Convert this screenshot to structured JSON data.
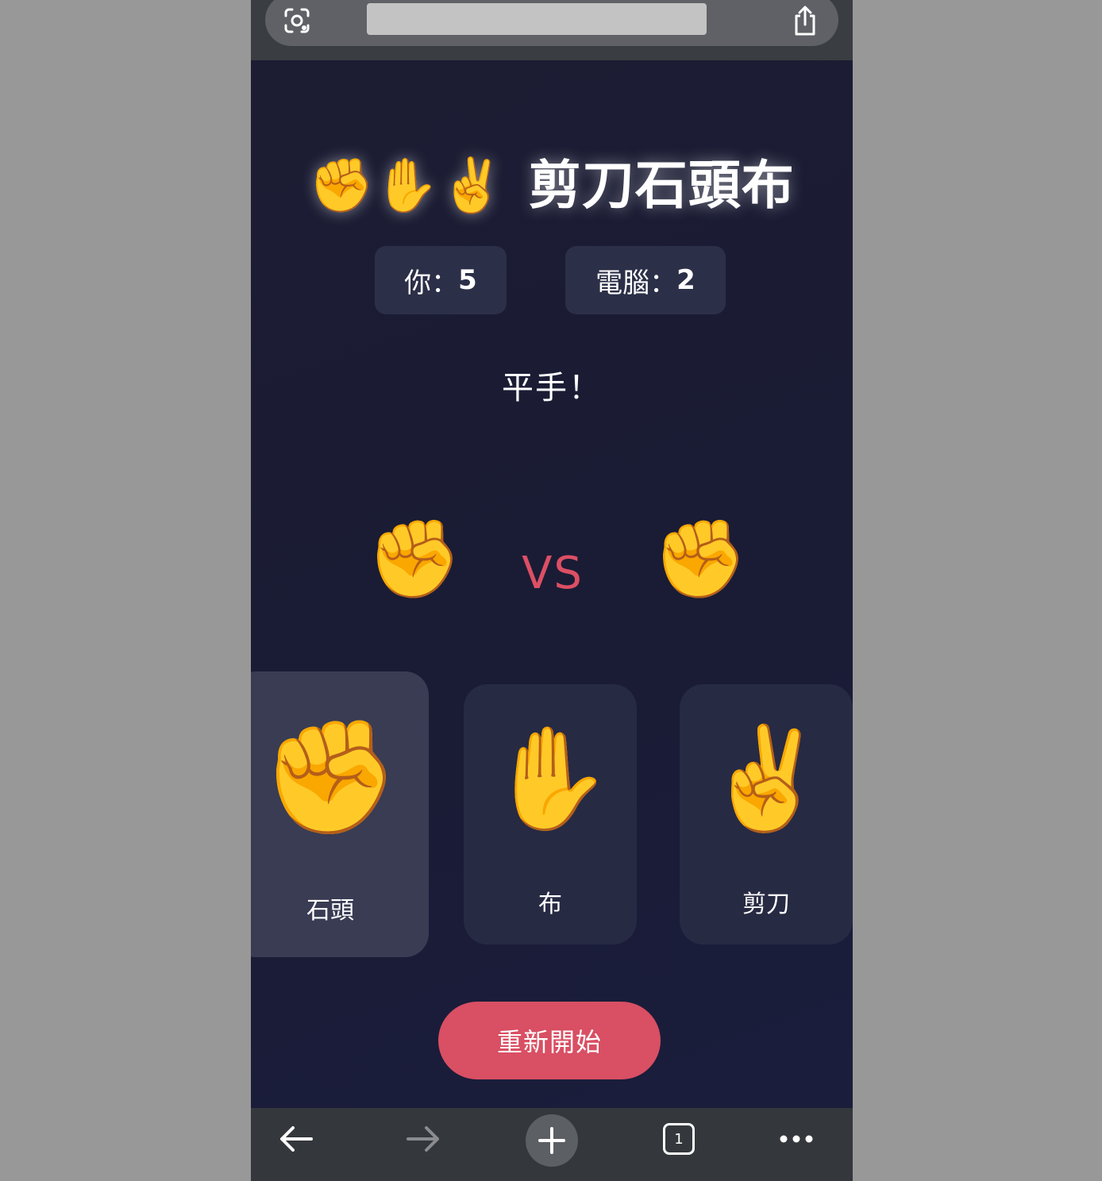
{
  "browser": {
    "lens_icon": "lens-icon",
    "share_icon": "share-icon"
  },
  "game": {
    "title_emojis": "✊✋✌️",
    "title_text": "剪刀石頭布",
    "score_player_label": "你：",
    "score_player_value": "5",
    "score_computer_label": "電腦：",
    "score_computer_value": "2",
    "result": "平手！",
    "player_hand": "✊",
    "computer_hand": "✊",
    "vs": "VS",
    "choices": [
      {
        "icon": "✊",
        "label": "石頭"
      },
      {
        "icon": "✋",
        "label": "布"
      },
      {
        "icon": "✌️",
        "label": "剪刀"
      }
    ],
    "restart_label": "重新開始"
  },
  "toolbar": {
    "tab_count": "1"
  },
  "colors": {
    "background": "#1b1e38",
    "accent": "#d94f63",
    "card": "#272a43",
    "card_selected": "#393c53"
  }
}
